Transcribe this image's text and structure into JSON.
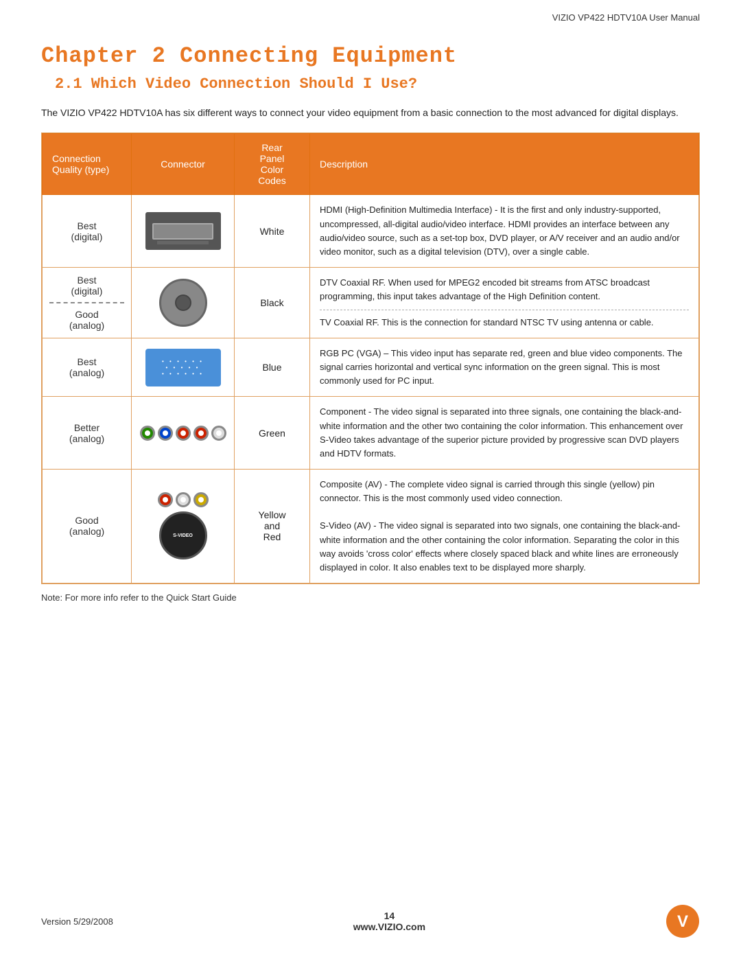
{
  "header": {
    "title": "VIZIO VP422 HDTV10A User Manual"
  },
  "chapter": {
    "title": "Chapter 2  Connecting Equipment",
    "section": "2.1 Which Video Connection Should I Use?",
    "intro": "The VIZIO VP422 HDTV10A has six different ways to connect your video equipment from a basic connection to the most advanced for digital displays."
  },
  "table": {
    "headers": {
      "quality": "Connection\nQuality (type)",
      "connector": "Connector",
      "color_codes": "Rear\nPanel\nColor\nCodes",
      "description": "Description"
    },
    "rows": [
      {
        "quality": "Best\n(digital)",
        "connector_type": "hdmi",
        "color": "White",
        "description": "HDMI (High-Definition Multimedia Interface) - It is the first and only industry-supported, uncompressed, all-digital audio/video interface. HDMI provides an interface between any audio/video source, such as a set-top box, DVD player, or A/V receiver and an audio and/or video monitor, such as a digital television (DTV), over a single cable."
      },
      {
        "quality": "Best\n(digital)\n\nGood\n(analog)",
        "connector_type": "rf",
        "color": "Black",
        "description1": "DTV Coaxial RF.  When used for MPEG2 encoded bit streams from ATSC broadcast programming, this input takes advantage of the High Definition content.",
        "description2": "TV Coaxial RF. This is the connection for standard NTSC TV using antenna or cable."
      },
      {
        "quality": "Best\n(analog)",
        "connector_type": "vga",
        "color": "Blue",
        "description": "RGB PC (VGA) – This video input has separate red, green and blue video components.   The signal carries horizontal and vertical sync information on the green signal.  This is most commonly used for PC input."
      },
      {
        "quality": "Better\n(analog)",
        "connector_type": "component",
        "color": "Green",
        "description": "Component - The video signal is separated into three signals, one containing the black-and-white information and the other two containing the color information. This enhancement over S-Video takes advantage of the superior picture provided by progressive scan DVD players and HDTV formats."
      },
      {
        "quality": "Good\n(analog)",
        "connector_type": "composite_svideo",
        "color": "Yellow\nand\nRed",
        "description1": "Composite (AV) - The complete video signal is carried through this single (yellow) pin connector. This is the most commonly used video connection.",
        "description2": "S-Video (AV) - The video signal is separated into two signals, one  containing  the  black-and-white information and the other containing the color information. Separating the color in this way avoids 'cross color' effects where closely spaced black and white lines are erroneously displayed in color.  It also enables text to be displayed more sharply."
      }
    ]
  },
  "note": "Note:  For more info refer to the Quick Start Guide",
  "footer": {
    "version": "Version 5/29/2008",
    "page": "14",
    "website": "www.VIZIO.com"
  }
}
